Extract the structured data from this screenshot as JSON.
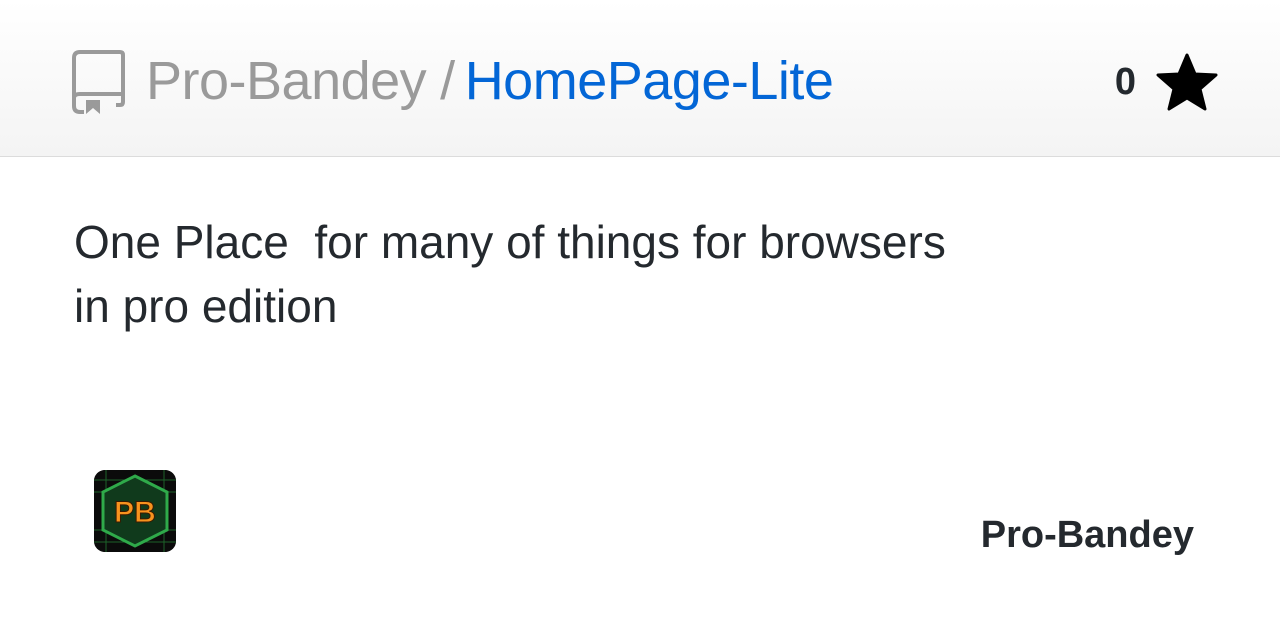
{
  "header": {
    "owner": "Pro-Bandey",
    "separator": "/",
    "repo_name": "HomePage-Lite",
    "repo_icon": "repo-book-icon",
    "star_count": "0",
    "star_icon": "star-icon"
  },
  "description": "One Place  for many of things for browsers\nin pro edition",
  "footer": {
    "avatar_text": "PB",
    "owner_name": "Pro-Bandey"
  },
  "colors": {
    "owner_gray": "#9a9a9a",
    "link_blue": "#0366d6",
    "text_dark": "#24292e",
    "avatar_orange": "#f7931e",
    "avatar_green": "#1f8b3a"
  }
}
